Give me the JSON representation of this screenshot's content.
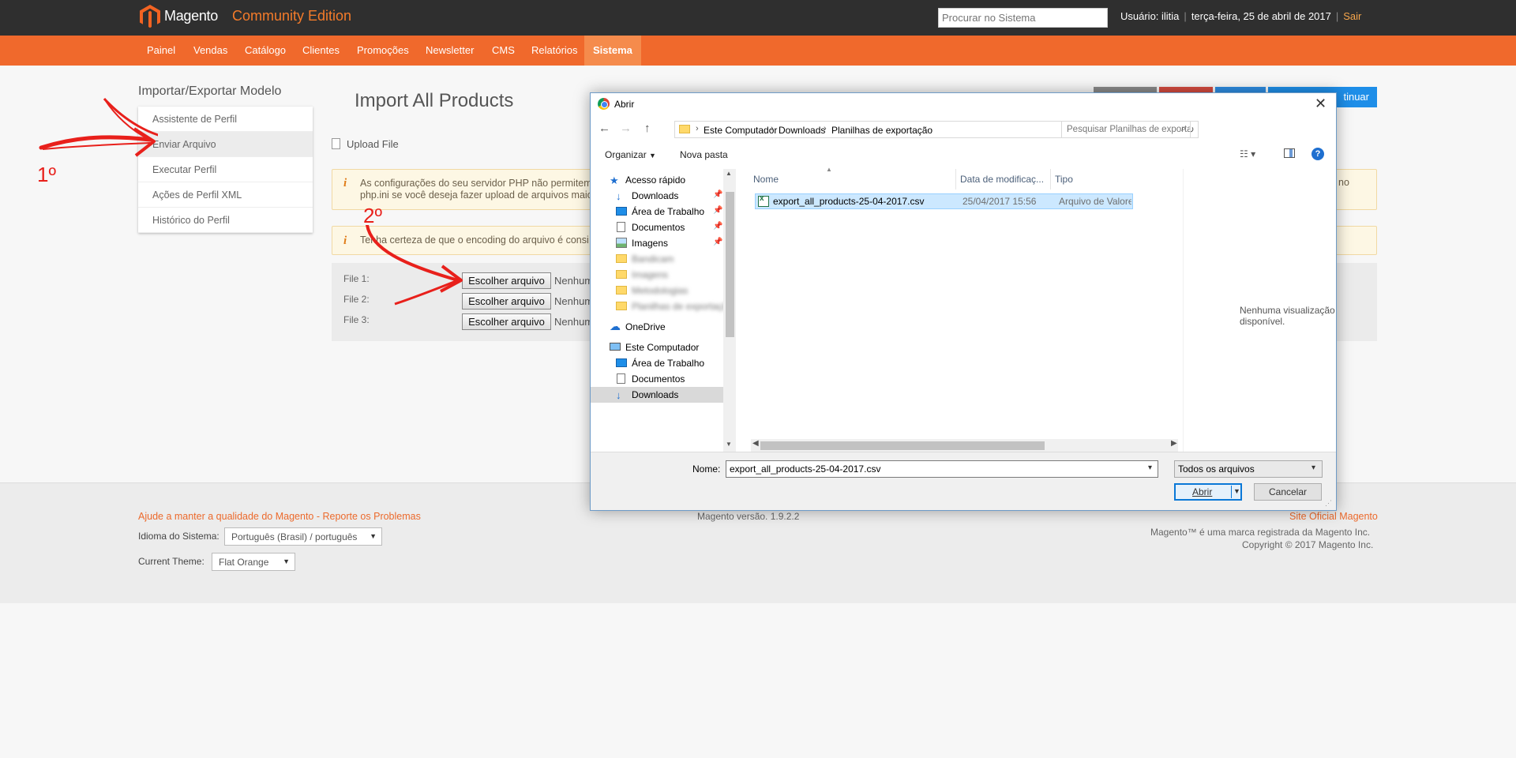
{
  "header": {
    "logo_text": "Magento",
    "edition": "Community Edition",
    "search_placeholder": "Procurar no Sistema",
    "user_label": "Usuário: ilitia",
    "date": "terça-feira, 25 de abril de 2017",
    "logout": "Sair"
  },
  "nav": [
    "Painel",
    "Vendas",
    "Catálogo",
    "Clientes",
    "Promoções",
    "Newsletter",
    "CMS",
    "Relatórios",
    "Sistema"
  ],
  "sidebar": {
    "title": "Importar/Exportar Modelo",
    "items": [
      "Assistente de Perfil",
      "Enviar Arquivo",
      "Executar Perfil",
      "Ações de Perfil XML",
      "Histórico do Perfil"
    ]
  },
  "main": {
    "title": "Import All Products",
    "continue_button": "tinuar",
    "upload_heading": "Upload File",
    "notice_php_line1": "As configurações do seu servidor PHP não permitem",
    "notice_php_line2": "php.ini se você deseja fazer upload de arquivos maio",
    "notice_php_tail": "no",
    "notice_encoding": "Tenha certeza de que o encoding do arquivo é consi",
    "files": [
      {
        "label": "File 1:",
        "button": "Escolher arquivo",
        "status": "Nenhum"
      },
      {
        "label": "File 2:",
        "button": "Escolher arquivo",
        "status": "Nenhum"
      },
      {
        "label": "File 3:",
        "button": "Escolher arquivo",
        "status": "Nenhum"
      }
    ]
  },
  "annotations": {
    "step1": "1º",
    "step2": "2º"
  },
  "footer": {
    "report_link": "Ajude a manter a qualidade do Magento - Reporte os Problemas",
    "version": "Magento versão. 1.9.2.2",
    "site_link": "Site Oficial Magento",
    "trademark": "Magento™ é uma marca registrada da Magento Inc.",
    "copyright": "Copyright © 2017 Magento Inc.",
    "language_label": "Idioma do Sistema:",
    "language_value": "Português (Brasil) / português",
    "theme_label": "Current Theme:",
    "theme_value": "Flat Orange"
  },
  "dialog": {
    "title": "Abrir",
    "breadcrumb": [
      "Este Computador",
      "Downloads",
      "Planilhas de exportação"
    ],
    "search_placeholder": "Pesquisar Planilhas de exporta...",
    "organize": "Organizar",
    "new_folder": "Nova pasta",
    "nav_items": [
      {
        "label": "Acesso rápido",
        "icon": "star-icon"
      },
      {
        "label": "Downloads",
        "icon": "download-icon"
      },
      {
        "label": "Área de Trabalho",
        "icon": "desktop-icon"
      },
      {
        "label": "Documentos",
        "icon": "documents-icon"
      },
      {
        "label": "Imagens",
        "icon": "images-icon"
      },
      {
        "label": "Bandicam",
        "icon": "folder-icon"
      },
      {
        "label": "Imagens",
        "icon": "folder-icon"
      },
      {
        "label": "Metodologias",
        "icon": "folder-icon"
      },
      {
        "label": "Planilhas de exportação",
        "icon": "folder-icon"
      },
      {
        "label": "OneDrive",
        "icon": "cloud-icon"
      },
      {
        "label": "Este Computador",
        "icon": "computer-icon"
      },
      {
        "label": "Área de Trabalho",
        "icon": "desktop-icon"
      },
      {
        "label": "Documentos",
        "icon": "documents-icon"
      },
      {
        "label": "Downloads",
        "icon": "download-icon"
      }
    ],
    "columns": [
      "Nome",
      "Data de modificaç...",
      "Tipo"
    ],
    "files": [
      {
        "name": "export_all_products-25-04-2017.csv",
        "modified": "25/04/2017 15:56",
        "type": "Arquivo de Valores"
      }
    ],
    "preview_text": "Nenhuma visualização disponível.",
    "name_label": "Nome:",
    "name_value": "export_all_products-25-04-2017.csv",
    "filter": "Todos os arquivos",
    "open_button": "Abrir",
    "cancel_button": "Cancelar"
  },
  "colors": {
    "brand_orange": "#f0692c",
    "header_dark": "#2f2f2f",
    "annotation_red": "#e8201b"
  }
}
